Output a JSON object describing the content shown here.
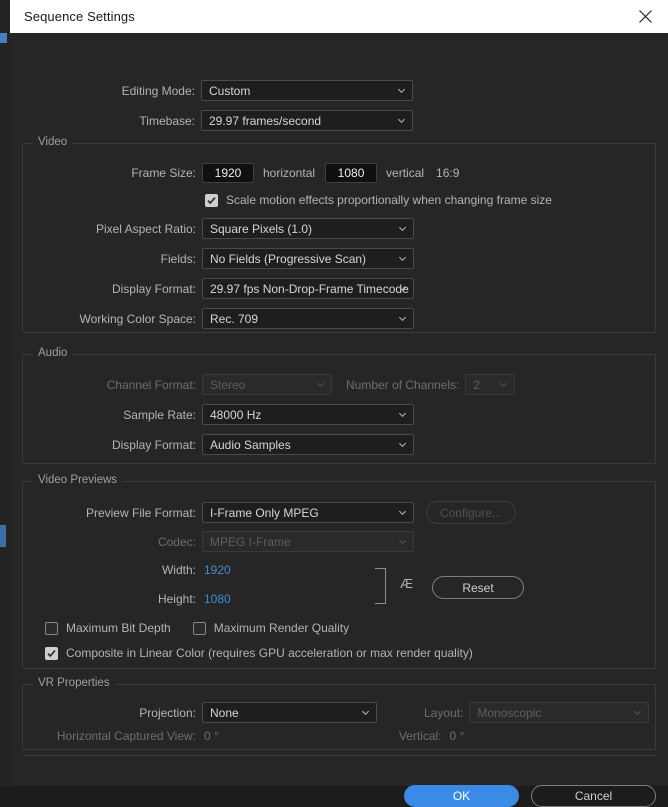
{
  "window": {
    "title": "Sequence Settings",
    "close_icon": "close-icon"
  },
  "top": {
    "editing_mode": {
      "label": "Editing Mode:",
      "value": "Custom"
    },
    "timebase": {
      "label": "Timebase:",
      "value": "29.97  frames/second"
    }
  },
  "video": {
    "legend": "Video",
    "frame_size": {
      "label": "Frame Size:",
      "horizontal_value": "1920",
      "horizontal_label": "horizontal",
      "vertical_value": "1080",
      "vertical_label": "vertical",
      "aspect_ratio": "16:9"
    },
    "scale_motion": {
      "label": "Scale motion effects proportionally when changing frame size",
      "checked": true
    },
    "pixel_aspect_ratio": {
      "label": "Pixel Aspect Ratio:",
      "value": "Square Pixels (1.0)"
    },
    "fields": {
      "label": "Fields:",
      "value": "No Fields (Progressive Scan)"
    },
    "display_format": {
      "label": "Display Format:",
      "value": "29.97 fps Non-Drop-Frame Timecode"
    },
    "working_color_space": {
      "label": "Working Color Space:",
      "value": "Rec. 709"
    }
  },
  "audio": {
    "legend": "Audio",
    "channel_format": {
      "label": "Channel Format:",
      "value": "Stereo",
      "disabled": true
    },
    "number_of_channels": {
      "label": "Number of Channels:",
      "value": "2",
      "disabled": true
    },
    "sample_rate": {
      "label": "Sample Rate:",
      "value": "48000 Hz"
    },
    "display_format": {
      "label": "Display Format:",
      "value": "Audio Samples"
    }
  },
  "video_previews": {
    "legend": "Video Previews",
    "preview_file_format": {
      "label": "Preview File Format:",
      "value": "I-Frame Only MPEG"
    },
    "configure_button": {
      "label": "Configure...",
      "disabled": true
    },
    "codec": {
      "label": "Codec:",
      "value": "MPEG I-Frame",
      "disabled": true
    },
    "width": {
      "label": "Width:",
      "value": "1920"
    },
    "height": {
      "label": "Height:",
      "value": "1080"
    },
    "reset_button": {
      "label": "Reset"
    },
    "max_bit_depth": {
      "label": "Maximum Bit Depth",
      "checked": false
    },
    "max_render_quality": {
      "label": "Maximum Render Quality",
      "checked": false
    },
    "composite_linear_color": {
      "label": "Composite in Linear Color (requires GPU acceleration or max render quality)",
      "checked": true
    }
  },
  "vr": {
    "legend": "VR Properties",
    "projection": {
      "label": "Projection:",
      "value": "None"
    },
    "layout": {
      "label": "Layout:",
      "value": "Monoscopic",
      "disabled": true
    },
    "horizontal_captured_view": {
      "label": "Horizontal Captured View:",
      "value": "0 °",
      "disabled": true
    },
    "vertical": {
      "label": "Vertical:",
      "value": "0 °",
      "disabled": true
    }
  },
  "footer": {
    "ok": "OK",
    "cancel": "Cancel"
  },
  "colors": {
    "accent_blue": "#3b8ae5",
    "value_blue": "#3f8ed0",
    "dialog_bg": "#262626",
    "titlebar_bg": "#ffffff"
  }
}
